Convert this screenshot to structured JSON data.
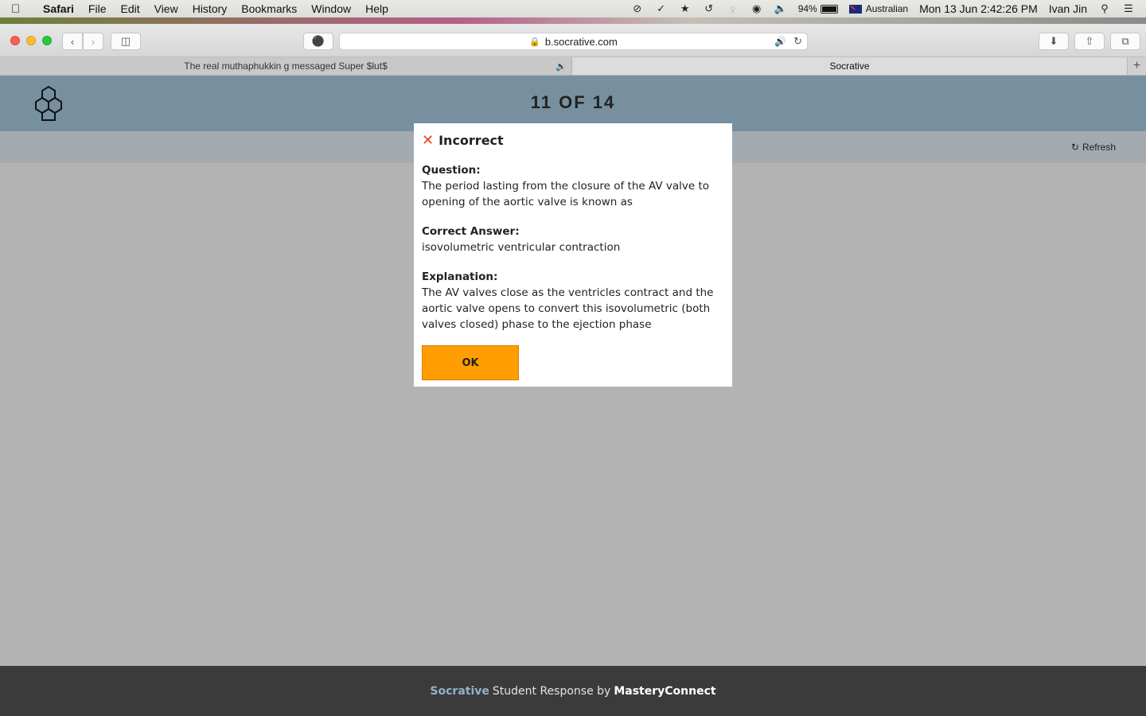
{
  "menubar": {
    "apple_icon": "apple-icon",
    "app_name": "Safari",
    "items": [
      "File",
      "Edit",
      "View",
      "History",
      "Bookmarks",
      "Window",
      "Help"
    ],
    "battery_percent": "94%",
    "input_source": "Australian",
    "datetime": "Mon 13 Jun  2:42:26 PM",
    "user": "Ivan Jin"
  },
  "browser": {
    "address": "b.socrative.com",
    "tabs": [
      {
        "title": "The real muthaphukkin g messaged Super $lut$",
        "active": false,
        "audio": true
      },
      {
        "title": "Socrative",
        "active": true,
        "audio": false
      }
    ]
  },
  "app": {
    "progress": "11  OF  14",
    "refresh_label": "Refresh"
  },
  "modal": {
    "title": "Incorrect",
    "question_label": "Question:",
    "question_text": "The period lasting from the closure of the AV valve to opening of the aortic valve is known as",
    "answer_label": "Correct Answer:",
    "answer_text": "isovolumetric ventricular contraction",
    "explanation_label": "Explanation:",
    "explanation_text": "The AV valves close as the ventricles contract and the aortic valve opens to convert this isovolumetric (both valves closed) phase to the ejection phase",
    "ok_label": "OK"
  },
  "footer": {
    "brand": "Socrative",
    "middle": "Student Response by",
    "company": "MasteryConnect"
  },
  "colors": {
    "header": "#7790a0",
    "ok_button": "#ff9e00",
    "error_icon": "#e8441c",
    "footer": "#3b3b3b"
  }
}
